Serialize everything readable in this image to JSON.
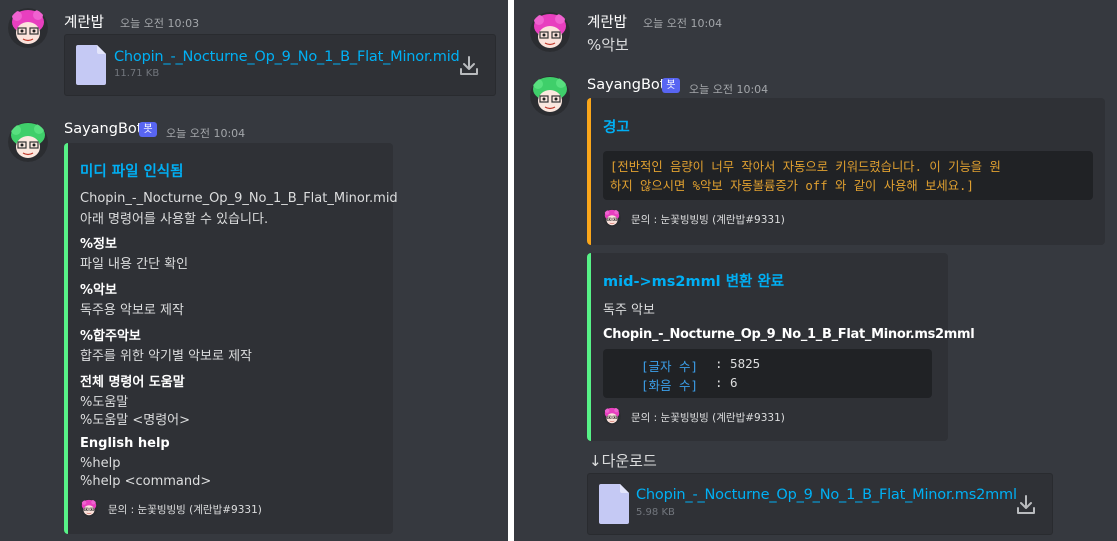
{
  "left": {
    "msg1": {
      "username": "계란밥",
      "timestamp": "오늘 오전 10:03",
      "attachment": {
        "name": "Chopin_-_Nocturne_Op_9_No_1_B_Flat_Minor.mid",
        "size": "11.71 KB"
      }
    },
    "msg2": {
      "username": "SayangBot",
      "badge": "봇",
      "timestamp": "오늘 오전 10:04",
      "embed": {
        "title": "미디 파일 인식됨",
        "line1": "Chopin_-_Nocturne_Op_9_No_1_B_Flat_Minor.mid",
        "line2": "아래 명령어를 사용할 수 있습니다.",
        "f1_name": "%정보",
        "f1_value": "파일 내용 간단 확인",
        "f2_name": "%악보",
        "f2_value": "독주용 악보로 제작",
        "f3_name": "%합주악보",
        "f3_value": "합주를 위한 악기별 악보로 제작",
        "f4_name": "전체 명령어 도움말",
        "f4_v1": "%도움말",
        "f4_v2": "%도움말 <명령어>",
        "f5_name": "English help",
        "f5_v1": "%help",
        "f5_v2": "%help <command>",
        "footer": "문의 : 눈꽃빙빙빙 (계란밥#9331)"
      }
    }
  },
  "right": {
    "msg1": {
      "username": "계란밥",
      "timestamp": "오늘 오전 10:04",
      "text": "%악보"
    },
    "msg2": {
      "username": "SayangBot",
      "badge": "봇",
      "timestamp": "오늘 오전 10:04",
      "warning": {
        "title": "경고",
        "code_line1": "[전반적인 음량이 너무 작아서 자동으로 키워드렸습니다. 이 기능을 원",
        "code_line2": "하지 않으시면 %악보 자동볼륨증가 off 와 같이 사용해 보세요.]",
        "footer": "문의 : 눈꽃빙빙빙 (계란밥#9331)"
      },
      "result": {
        "title": "mid->ms2mml 변환 완료",
        "subtitle": "독주 악보",
        "filename": "Chopin_-_Nocturne_Op_9_No_1_B_Flat_Minor.ms2mml",
        "row1_label": "[글자 수]",
        "row1_value": ": 5825",
        "row2_label": "[화음 수]",
        "row2_value": ": 6",
        "footer": "문의 : 눈꽃빙빙빙 (계란밥#9331)"
      },
      "download_label": "↓다운로드",
      "attachment": {
        "name": "Chopin_-_Nocturne_Op_9_No_1_B_Flat_Minor.ms2mml",
        "size": "5.98 KB"
      }
    }
  },
  "icons": {
    "avatar_user": "pink-haired-avatar-icon",
    "avatar_bot": "green-haired-avatar-icon",
    "file": "file-icon",
    "download": "download-icon"
  },
  "colors": {
    "embed_green": "#57f287",
    "embed_orange": "#faa61a",
    "link": "#00aff4",
    "badge": "#5865f2",
    "warn_text": "#e0a030"
  }
}
